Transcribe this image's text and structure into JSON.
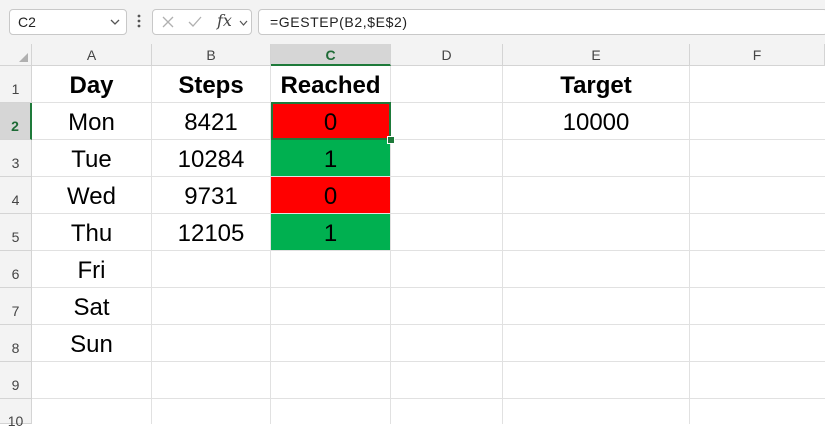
{
  "name_box": {
    "value": "C2",
    "dropdown_icon": "chevron-down-icon"
  },
  "formula_bar": {
    "formula": "=GESTEP(B2,$E$2)",
    "cancel_icon": "close-icon",
    "enter_icon": "checkmark-icon",
    "function_label": "fx",
    "expand_icon": "chevron-down-icon"
  },
  "columns": [
    "A",
    "B",
    "C",
    "D",
    "E",
    "F"
  ],
  "rows": [
    "1",
    "2",
    "3",
    "4",
    "5",
    "6",
    "7",
    "8",
    "9",
    "10"
  ],
  "selected_cell": "C2",
  "headers": {
    "day": "Day",
    "steps": "Steps",
    "reached": "Reached",
    "target": "Target"
  },
  "target_value": "10000",
  "table": [
    {
      "day": "Mon",
      "steps": "8421",
      "reached": "0"
    },
    {
      "day": "Tue",
      "steps": "10284",
      "reached": "1"
    },
    {
      "day": "Wed",
      "steps": "9731",
      "reached": "0"
    },
    {
      "day": "Thu",
      "steps": "12105",
      "reached": "1"
    },
    {
      "day": "Fri",
      "steps": "",
      "reached": ""
    },
    {
      "day": "Sat",
      "steps": "",
      "reached": ""
    },
    {
      "day": "Sun",
      "steps": "",
      "reached": ""
    }
  ],
  "colors": {
    "not_reached_fill": "#ff0000",
    "reached_fill": "#00b050",
    "selection": "#1e7a3a"
  }
}
